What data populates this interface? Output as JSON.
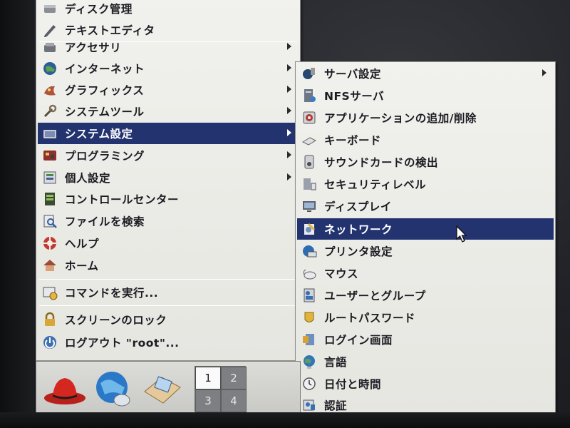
{
  "main_menu": {
    "items": [
      {
        "label": "ディスク管理",
        "icon": "disk-icon",
        "submenu": false
      },
      {
        "label": "テキストエディタ",
        "icon": "text-editor-icon",
        "submenu": false
      },
      {
        "label": "アクセサリ",
        "icon": "accessories-icon",
        "submenu": true
      },
      {
        "label": "インターネット",
        "icon": "globe-icon",
        "submenu": true
      },
      {
        "label": "グラフィックス",
        "icon": "graphics-icon",
        "submenu": true
      },
      {
        "label": "システムツール",
        "icon": "system-tools-icon",
        "submenu": true
      },
      {
        "label": "システム設定",
        "icon": "system-settings-icon",
        "submenu": true,
        "selected": true
      },
      {
        "label": "プログラミング",
        "icon": "programming-icon",
        "submenu": true
      },
      {
        "label": "個人設定",
        "icon": "preferences-icon",
        "submenu": true
      },
      {
        "label": "コントロールセンター",
        "icon": "control-center-icon",
        "submenu": false
      },
      {
        "label": "ファイルを検索",
        "icon": "search-files-icon",
        "submenu": false
      },
      {
        "label": "ヘルプ",
        "icon": "help-icon",
        "submenu": false
      },
      {
        "label": "ホーム",
        "icon": "home-icon",
        "submenu": false
      },
      {
        "label": "コマンドを実行...",
        "icon": "run-command-icon",
        "submenu": false
      },
      {
        "label": "スクリーンのロック",
        "icon": "lock-icon",
        "submenu": false
      },
      {
        "label": "ログアウト \"root\"...",
        "icon": "logout-icon",
        "submenu": false
      }
    ]
  },
  "sub_menu": {
    "items": [
      {
        "label": "サーバ設定",
        "icon": "server-settings-icon",
        "submenu": true
      },
      {
        "label": "NFSサーバ",
        "icon": "nfs-server-icon",
        "submenu": false
      },
      {
        "label": "アプリケーションの追加/削除",
        "icon": "add-remove-apps-icon",
        "submenu": false
      },
      {
        "label": "キーボード",
        "icon": "keyboard-icon",
        "submenu": false
      },
      {
        "label": "サウンドカードの検出",
        "icon": "sound-card-icon",
        "submenu": false
      },
      {
        "label": "セキュリティレベル",
        "icon": "security-level-icon",
        "submenu": false
      },
      {
        "label": "ディスプレイ",
        "icon": "display-icon",
        "submenu": false
      },
      {
        "label": "ネットワーク",
        "icon": "network-icon",
        "submenu": false,
        "selected": true
      },
      {
        "label": "プリンタ設定",
        "icon": "printer-icon",
        "submenu": false
      },
      {
        "label": "マウス",
        "icon": "mouse-icon",
        "submenu": false
      },
      {
        "label": "ユーザーとグループ",
        "icon": "users-groups-icon",
        "submenu": false
      },
      {
        "label": "ルートパスワード",
        "icon": "root-password-icon",
        "submenu": false
      },
      {
        "label": "ログイン画面",
        "icon": "login-screen-icon",
        "submenu": false
      },
      {
        "label": "言語",
        "icon": "language-icon",
        "submenu": false
      },
      {
        "label": "日付と時間",
        "icon": "date-time-icon",
        "submenu": false
      },
      {
        "label": "認証",
        "icon": "authentication-icon",
        "submenu": false
      }
    ]
  },
  "panel": {
    "launchers": [
      {
        "icon": "red-hat-icon"
      },
      {
        "icon": "web-browser-icon"
      },
      {
        "icon": "email-icon"
      }
    ],
    "pager": [
      "1",
      "2",
      "3",
      "4"
    ],
    "active_workspace": "1"
  },
  "colors": {
    "selection": "#23336f",
    "menu_bg": "#ecece8"
  }
}
